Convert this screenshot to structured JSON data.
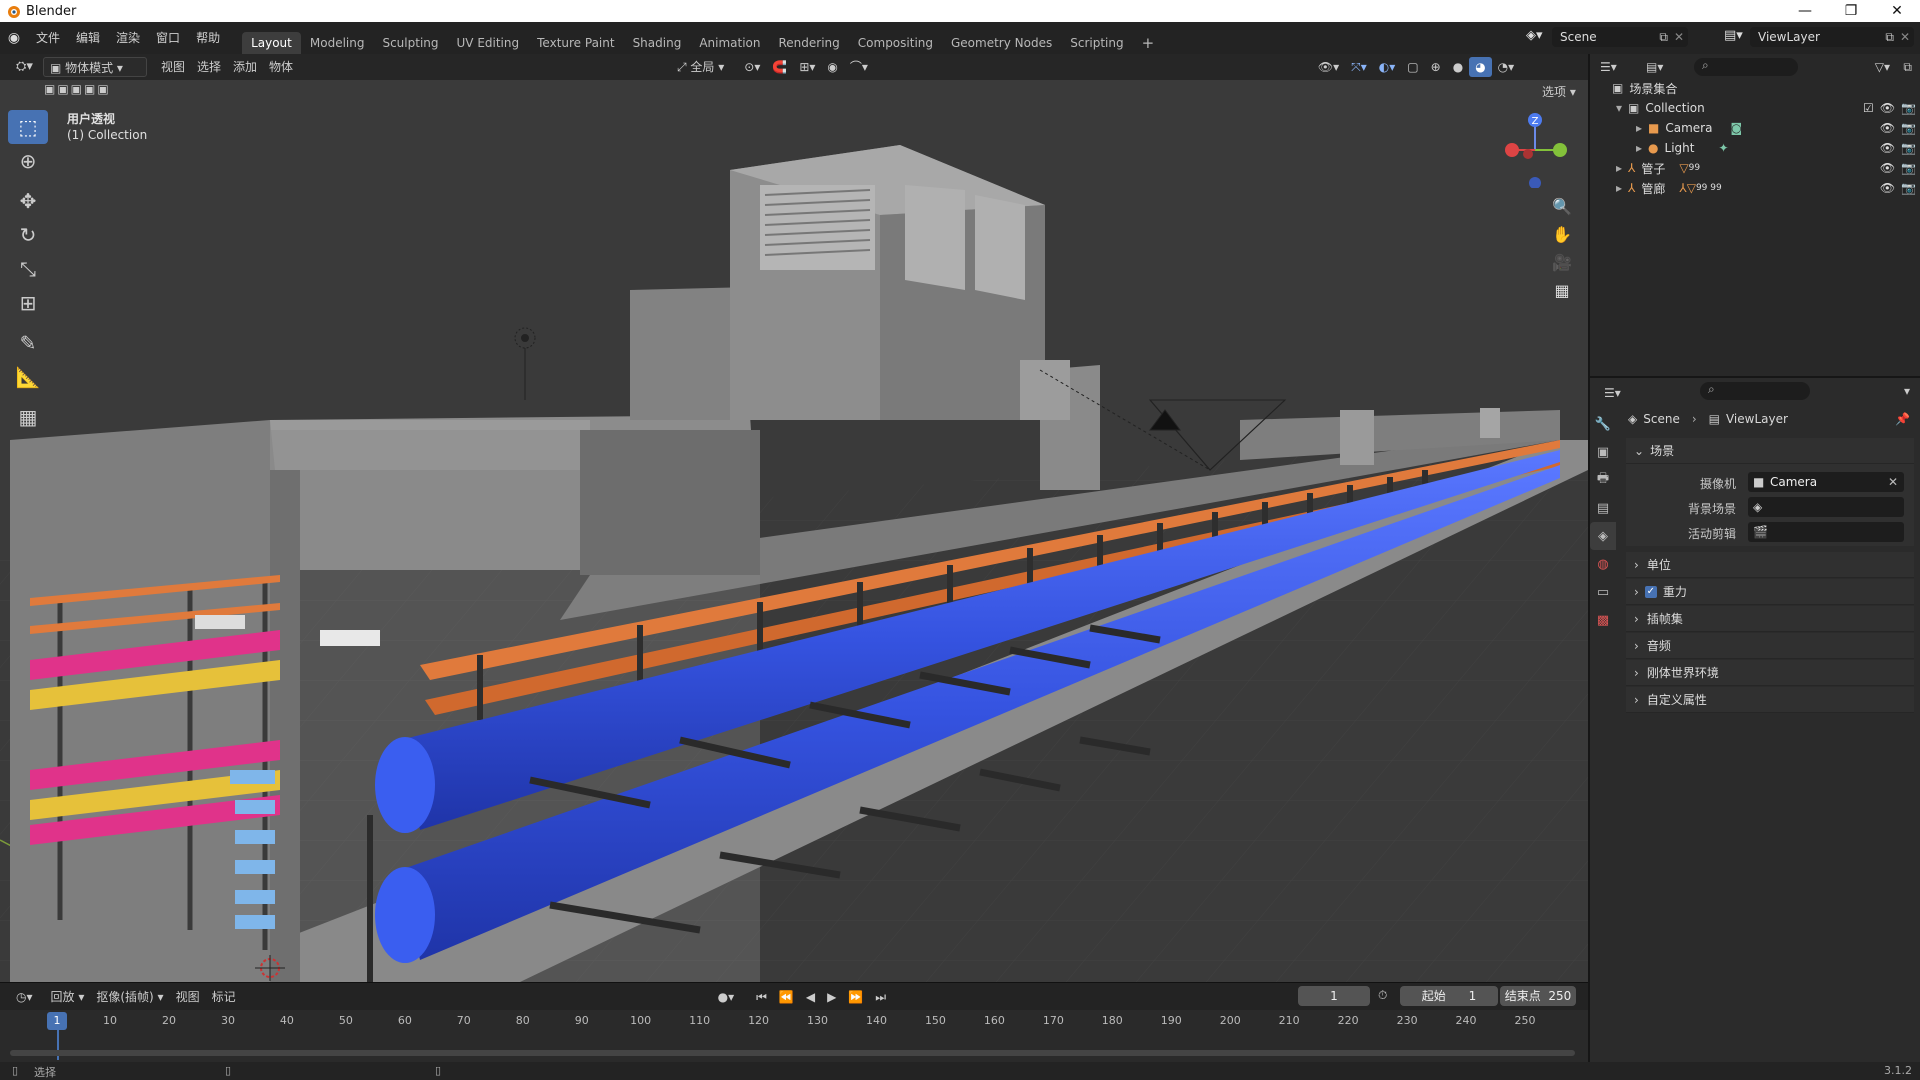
{
  "window": {
    "title": "Blender",
    "minimize": "—",
    "maximize": "❐",
    "close": "✕"
  },
  "menu": [
    "文件",
    "编辑",
    "渲染",
    "窗口",
    "帮助"
  ],
  "workspaces": [
    "Layout",
    "Modeling",
    "Sculpting",
    "UV Editing",
    "Texture Paint",
    "Shading",
    "Animation",
    "Rendering",
    "Compositing",
    "Geometry Nodes",
    "Scripting"
  ],
  "add_workspace": "+",
  "scene_name": "Scene",
  "view_layer_name": "ViewLayer",
  "viewport": {
    "mode": "物体模式",
    "menus": [
      "视图",
      "选择",
      "添加",
      "物体"
    ],
    "transform_orientation": "全局",
    "options_label": "选项",
    "view_name": "用户透视",
    "collection_info": "(1) Collection",
    "gizmo": {
      "z": "Z"
    }
  },
  "outliner": {
    "root": "场景集合",
    "rows": [
      {
        "label": "Collection",
        "indent": 1
      },
      {
        "label": "Camera",
        "indent": 2
      },
      {
        "label": "Light",
        "indent": 2
      },
      {
        "label": "管子",
        "indent": 1,
        "badge": "99"
      },
      {
        "label": "管廊",
        "indent": 1,
        "badge": "99 99"
      }
    ]
  },
  "properties": {
    "breadcrumb_scene": "Scene",
    "breadcrumb_viewlayer": "ViewLayer",
    "section": "场景",
    "camera_label": "摄像机",
    "camera_value": "Camera",
    "bg_scene_label": "背景场景",
    "active_clip_label": "活动剪辑",
    "panels": [
      "单位",
      "重力",
      "插帧集",
      "音频",
      "刚体世界环境",
      "自定义属性"
    ]
  },
  "timeline": {
    "menus": [
      "回放",
      "抠像(插帧)",
      "视图",
      "标记"
    ],
    "current_frame": "1",
    "start_label": "起始",
    "start_value": "1",
    "end_label": "结束点",
    "end_value": "250",
    "ruler": [
      "1",
      "10",
      "20",
      "30",
      "40",
      "50",
      "60",
      "70",
      "80",
      "90",
      "100",
      "110",
      "120",
      "130",
      "140",
      "150",
      "160",
      "170",
      "180",
      "190",
      "200",
      "210",
      "220",
      "230",
      "240",
      "250"
    ]
  },
  "status": {
    "select": "选择",
    "version": "3.1.2"
  },
  "colors": {
    "accent": "#4772b3",
    "pipe_blue": "#3355dd",
    "rail_orange": "#e07a3c",
    "cable_pink": "#e0338a",
    "cable_yellow": "#e6c13a",
    "cable_lightblue": "#7fb6ea"
  }
}
